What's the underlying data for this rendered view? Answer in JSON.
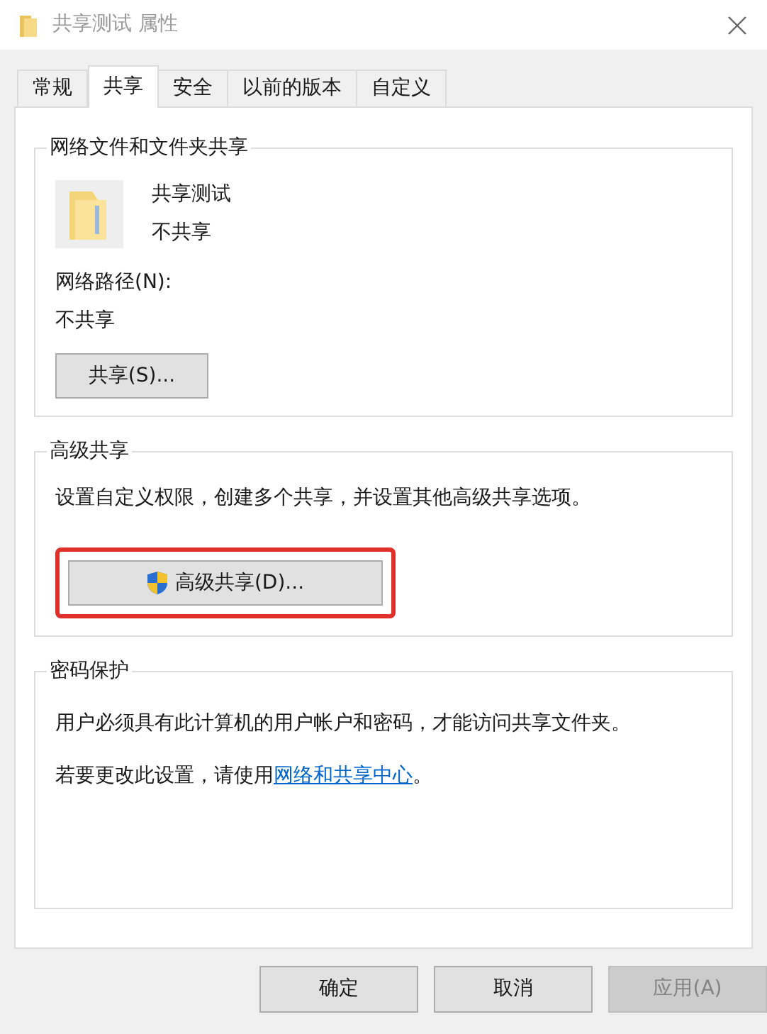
{
  "window": {
    "title": "共享测试 属性"
  },
  "tabs": [
    {
      "label": "常规",
      "selected": false
    },
    {
      "label": "共享",
      "selected": true
    },
    {
      "label": "安全",
      "selected": false
    },
    {
      "label": "以前的版本",
      "selected": false
    },
    {
      "label": "自定义",
      "selected": false
    }
  ],
  "network_sharing": {
    "title": "网络文件和文件夹共享",
    "folder_name": "共享测试",
    "status": "不共享",
    "path_label": "网络路径(N):",
    "path_value": "不共享",
    "button": "共享(S)..."
  },
  "advanced_sharing": {
    "title": "高级共享",
    "description": "设置自定义权限，创建多个共享，并设置其他高级共享选项。",
    "button": {
      "label": "高级共享(D)...",
      "highlighted": true
    }
  },
  "password_protection": {
    "title": "密码保护",
    "description": "用户必须具有此计算机的用户帐户和密码，才能访问共享文件夹。",
    "change_text": "若要更改此设置，请使用",
    "link": "网络和共享中心",
    "end": "。"
  },
  "buttons": [
    {
      "label": "确定",
      "disabled": false
    },
    {
      "label": "取消",
      "disabled": false
    },
    {
      "label": "应用(A)",
      "disabled": true
    }
  ]
}
